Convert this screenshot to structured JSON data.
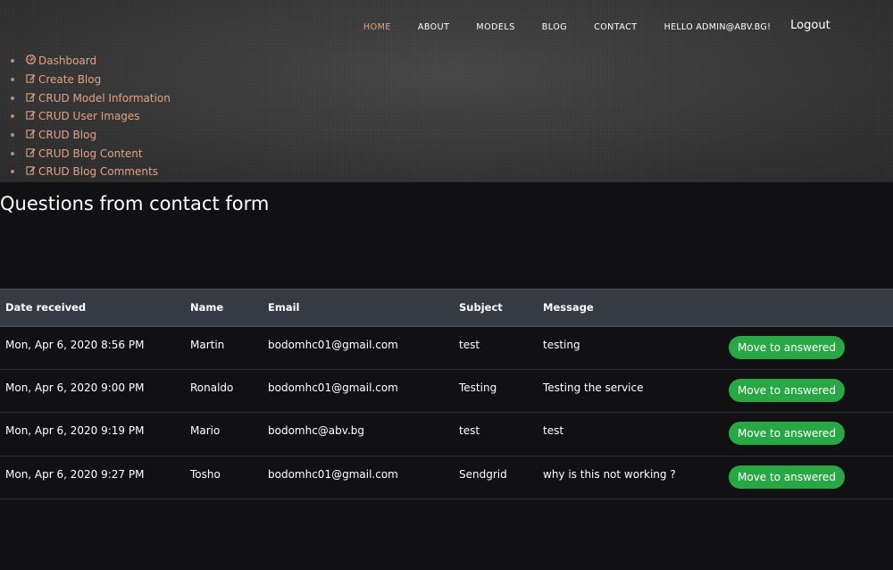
{
  "nav": {
    "links": [
      "HOME",
      "ABOUT",
      "MODELS",
      "BLOG",
      "CONTACT"
    ],
    "user_greeting": "HELLO ADMIN@ABV.BG!",
    "logout": "Logout",
    "active_color": "#e3a083"
  },
  "admin_menu": [
    {
      "icon": "dashboard-icon",
      "label": "Dashboard"
    },
    {
      "icon": "edit-icon",
      "label": "Create Blog"
    },
    {
      "icon": "edit-icon",
      "label": "CRUD Model Information"
    },
    {
      "icon": "edit-icon",
      "label": "CRUD User Images"
    },
    {
      "icon": "edit-icon",
      "label": "CRUD Blog"
    },
    {
      "icon": "edit-icon",
      "label": "CRUD Blog Content"
    },
    {
      "icon": "edit-icon",
      "label": "CRUD Blog Comments"
    }
  ],
  "page": {
    "title": "Questions from contact form"
  },
  "table": {
    "headers": [
      "Date received",
      "Name",
      "Email",
      "Subject",
      "Message"
    ],
    "rows": [
      {
        "date": "Mon, Apr 6, 2020 8:56 PM",
        "name": "Martin",
        "email": "bodomhc01@gmail.com",
        "subject": "test",
        "message": "testing",
        "action": "Move to answered"
      },
      {
        "date": "Mon, Apr 6, 2020 9:00 PM",
        "name": "Ronaldo",
        "email": "bodomhc01@gmail.com",
        "subject": "Testing",
        "message": "Testing the service",
        "action": "Move to answered"
      },
      {
        "date": "Mon, Apr 6, 2020 9:19 PM",
        "name": "Mario",
        "email": "bodomhc@abv.bg",
        "subject": "test",
        "message": "test",
        "action": "Move to answered"
      },
      {
        "date": "Mon, Apr 6, 2020 9:27 PM",
        "name": "Tosho",
        "email": "bodomhc01@gmail.com",
        "subject": "Sendgrid",
        "message": "why is this not working ?",
        "action": "Move to answered"
      }
    ]
  },
  "colors": {
    "accent": "#e3a083",
    "button": "#28a745",
    "header_bg": "#353b44",
    "page_bg": "#111114"
  }
}
